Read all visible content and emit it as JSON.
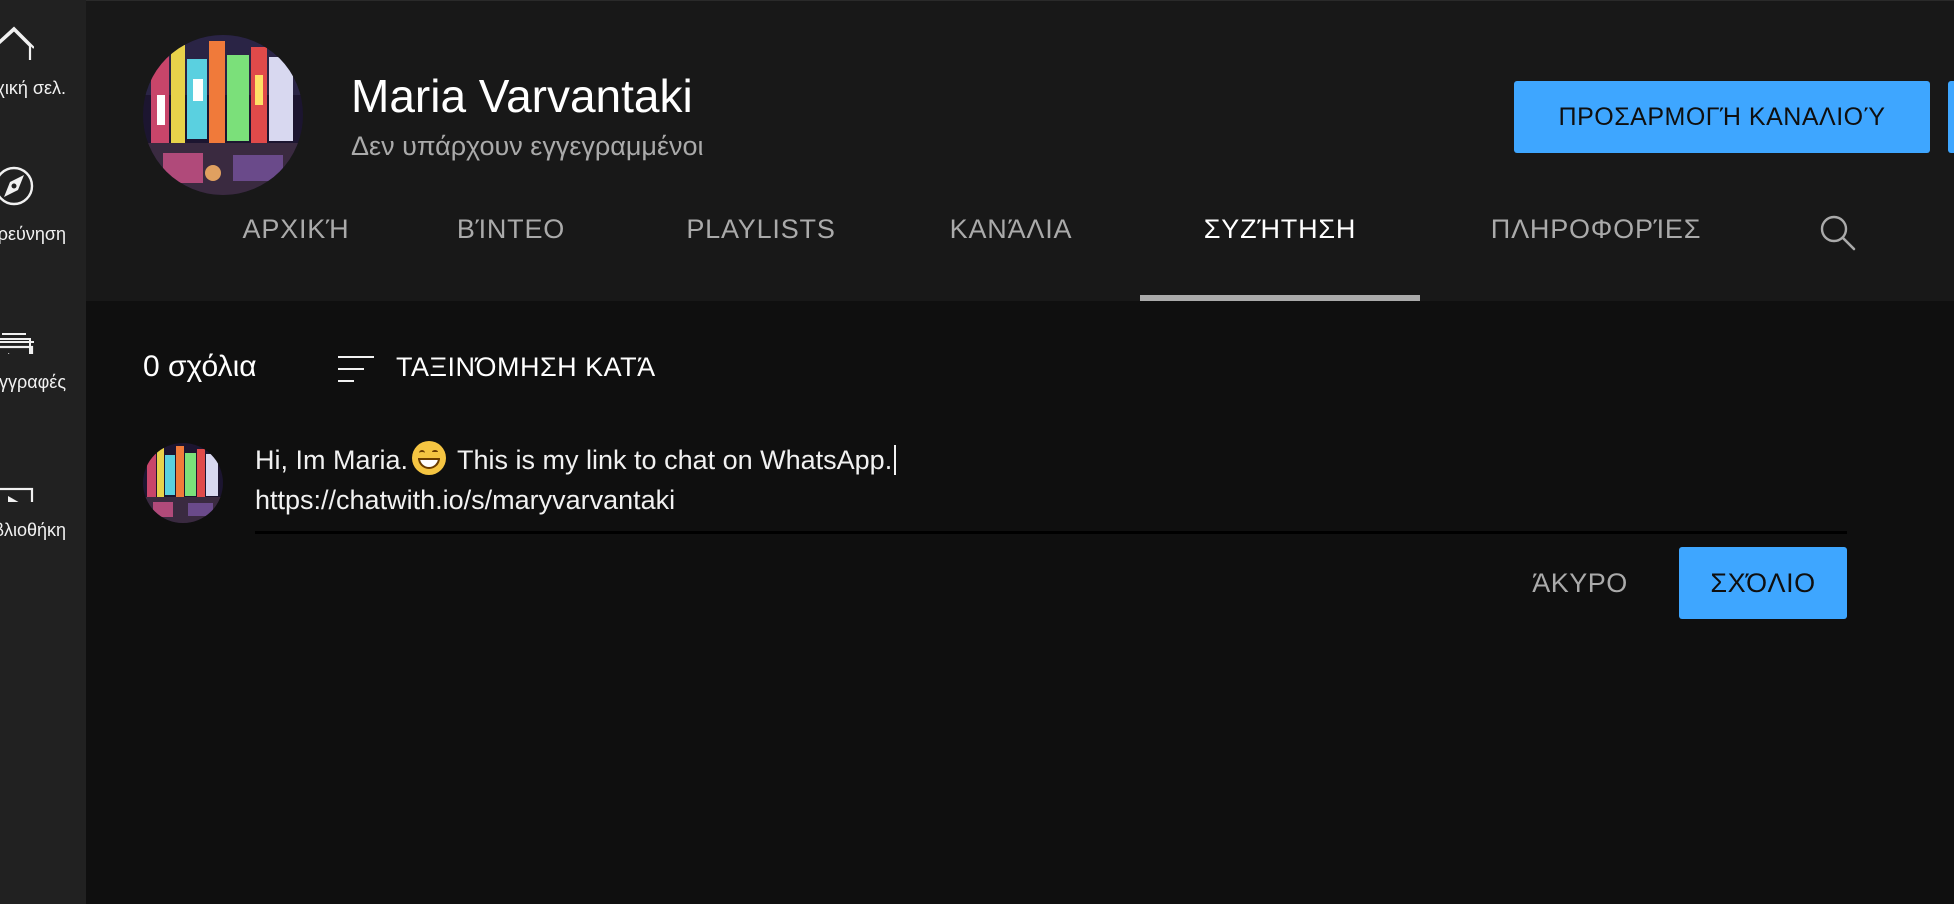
{
  "guide": {
    "items": [
      {
        "label": "Αρχική σελ.",
        "icon": "home-icon"
      },
      {
        "label": "Εξερεύνηση",
        "icon": "compass-icon"
      },
      {
        "label": "Εγγραφές",
        "icon": "subscriptions-icon"
      },
      {
        "label": "Βιβλιοθήκη",
        "icon": "library-icon"
      }
    ]
  },
  "channel": {
    "name": "Maria Varvantaki",
    "subscribers": "Δεν υπάρχουν εγγεγραμμένοι",
    "customize_label": "ΠΡΟΣΑΡΜΟΓΉ ΚΑΝΑΛΙΟΎ"
  },
  "tabs": [
    {
      "label": "ΑΡΧΙΚΉ"
    },
    {
      "label": "ΒΊΝΤΕΟ"
    },
    {
      "label": "PLAYLISTS"
    },
    {
      "label": "ΚΑΝΆΛΙΑ"
    },
    {
      "label": "ΣΥΖΉΤΗΣΗ",
      "active": true
    },
    {
      "label": "ΠΛΗΡΟΦΟΡΊΕΣ"
    }
  ],
  "comments": {
    "count_label": "0 σχόλια",
    "sort_label": "ΤΑΞΙΝΌΜΗΣΗ ΚΑΤΆ",
    "draft_line1_before": "Hi, Im Maria.",
    "draft_line1_after": " This is my link to chat on WhatsApp.",
    "draft_line2": "https://chatwith.io/s/maryvarvantaki",
    "cancel_label": "ΆΚΥΡΟ",
    "submit_label": "ΣΧΌΛΙΟ"
  },
  "colors": {
    "accent": "#3ea6ff",
    "background": "#0f0f0f",
    "header": "#181818",
    "guide": "#212121"
  }
}
